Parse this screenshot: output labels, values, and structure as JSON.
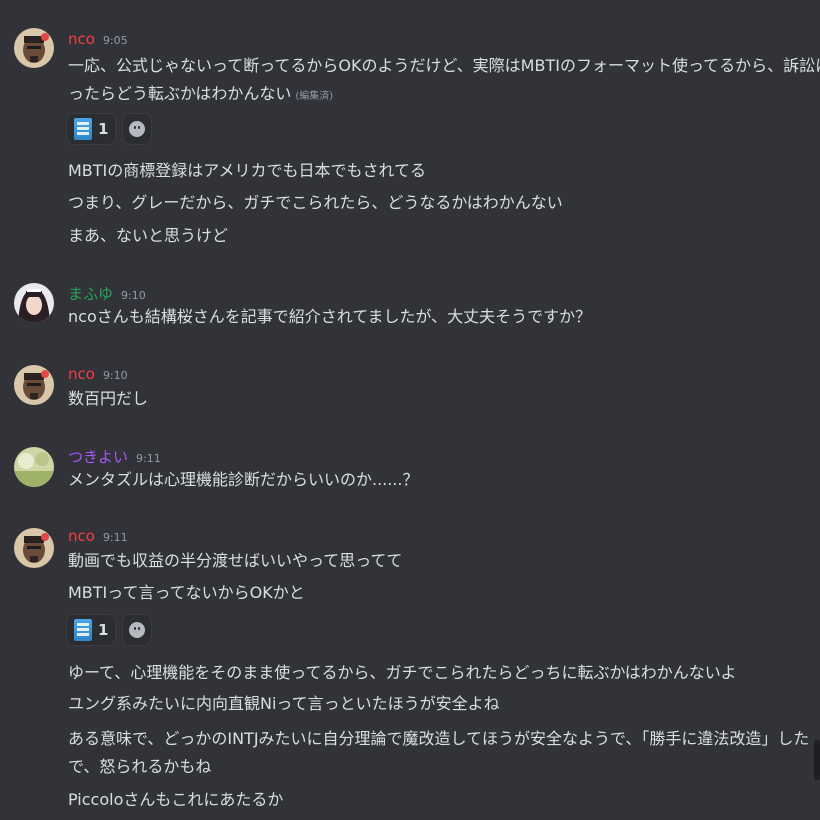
{
  "colors": {
    "background": "#313338",
    "nco": "#f23f43",
    "mafuyu": "#23a55a",
    "tsukiyoi": "#a855f7",
    "text": "#dbdee1",
    "muted": "#949ba4"
  },
  "messages": [
    {
      "author": "nco",
      "time": "9:05",
      "lines": [
        "一応、公式じゃないって断ってるからOKのようだけど、実際はMBTIのフォーマット使ってるから、訴訟にな",
        "ったらどう転ぶかはわかんない"
      ],
      "edited_label": "(編集済)",
      "reaction_count": "1",
      "followups": [
        "MBTIの商標登録はアメリカでも日本でもされてる",
        "つまり、グレーだから、ガチでこられたら、どうなるかはわかんない",
        "まあ、ないと思うけど"
      ]
    },
    {
      "author": "まふゆ",
      "time": "9:10",
      "lines": [
        "ncoさんも結構桜さんを記事で紹介されてましたが、大丈夫そうですか？"
      ]
    },
    {
      "author": "nco",
      "time": "9:10",
      "lines": [
        "数百円だし"
      ]
    },
    {
      "author": "つきよい",
      "time": "9:11",
      "lines": [
        "メンタズルは心理機能診断だからいいのか......？"
      ]
    },
    {
      "author": "nco",
      "time": "9:11",
      "lines": [
        "動画でも収益の半分渡せばいいやって思ってて",
        "MBTIって言ってないからOKかと"
      ],
      "reaction_count": "1",
      "followups": [
        "ゆーて、心理機能をそのまま使ってるから、ガチでこられたらどっちに転ぶかはわかんないよ",
        "ユング系みたいに内向直観Niって言っといたほうが安全よね",
        "ある意味で、どっかのINTJみたいに自分理論で魔改造してほうが安全なようで、「勝手に違法改造」した",
        "で、怒られるかもね",
        "Piccoloさんもこれにあたるか"
      ]
    }
  ]
}
